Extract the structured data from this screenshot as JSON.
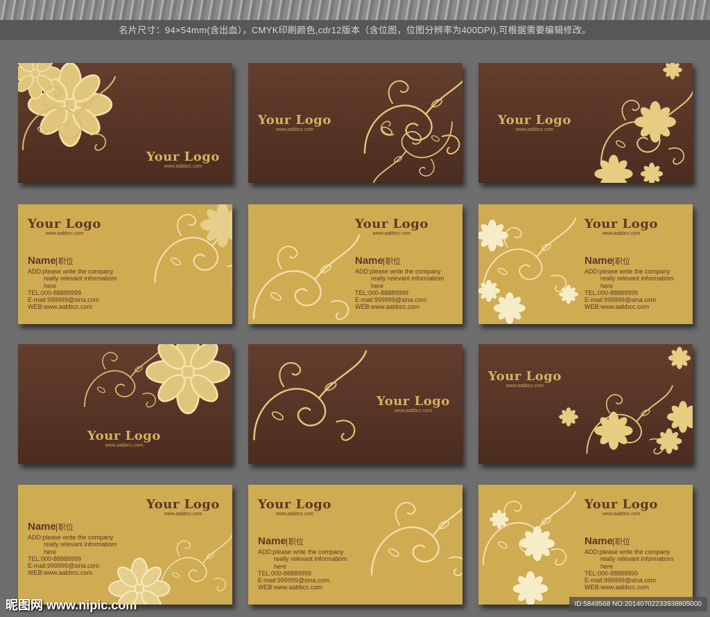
{
  "caption": "名片尺寸：94×54mm(含出血），CMYK印刷颜色,cdr12版本（含位图，位图分辨率为400DPI),可根据需要编辑修改。",
  "logo": {
    "title": "Your Logo",
    "url": "www.aabbcc.com"
  },
  "contact": {
    "name": "Name",
    "title": "职位",
    "add1": "ADD:please write the company",
    "add2": "really relevant informatiom",
    "add3": "here",
    "tel": "TEL:000-88889999",
    "email": "E-mail:999999@sina.com",
    "web": "WEB:www.aabbcc.com"
  },
  "watermark": {
    "site": "昵图网 www.nipic.com",
    "id": "ID:5849568 NO:20140702233938805000"
  },
  "colors": {
    "brown": "#5d3727",
    "gold": "#cfab52",
    "text": "#5a3a24",
    "ornament": "#e8d08a"
  }
}
